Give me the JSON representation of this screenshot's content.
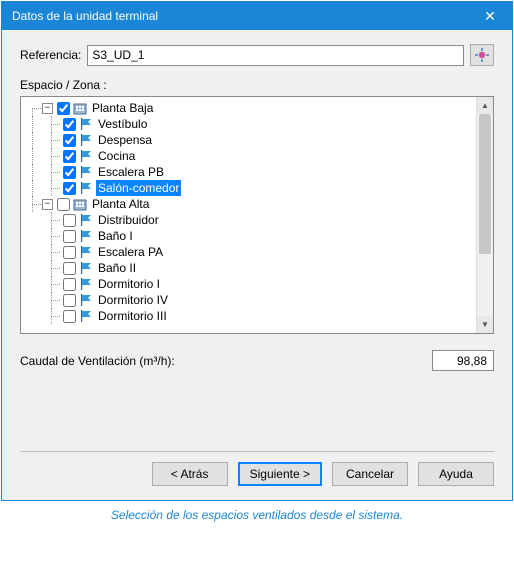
{
  "window": {
    "title": "Datos de la unidad terminal",
    "close_glyph": "✕"
  },
  "reference": {
    "label": "Referencia:",
    "value": "S3_UD_1"
  },
  "section_label": "Espacio / Zona :",
  "tree": {
    "groups": [
      {
        "label": "Planta Baja",
        "expanded": true,
        "checked": true,
        "children": [
          {
            "label": "Vestíbulo",
            "checked": true,
            "selected": false
          },
          {
            "label": "Despensa",
            "checked": true,
            "selected": false
          },
          {
            "label": "Cocina",
            "checked": true,
            "selected": false
          },
          {
            "label": "Escalera PB",
            "checked": true,
            "selected": false
          },
          {
            "label": "Salón-comedor",
            "checked": true,
            "selected": true
          }
        ]
      },
      {
        "label": "Planta Alta",
        "expanded": true,
        "checked": false,
        "children": [
          {
            "label": "Distribuidor",
            "checked": false,
            "selected": false
          },
          {
            "label": "Baño I",
            "checked": false,
            "selected": false
          },
          {
            "label": "Escalera PA",
            "checked": false,
            "selected": false
          },
          {
            "label": "Baño II",
            "checked": false,
            "selected": false
          },
          {
            "label": "Dormitorio I",
            "checked": false,
            "selected": false
          },
          {
            "label": "Dormitorio IV",
            "checked": false,
            "selected": false
          },
          {
            "label": "Dormitorio III",
            "checked": false,
            "selected": false
          }
        ]
      }
    ]
  },
  "caudal": {
    "label": "Caudal de Ventilación (m³/h):",
    "value": "98,88"
  },
  "buttons": {
    "back": "< Atrás",
    "next": "Siguiente >",
    "cancel": "Cancelar",
    "help": "Ayuda"
  },
  "caption": "Selección de los espacios ventilados desde el sistema.",
  "glyphs": {
    "minus": "−",
    "up": "▲",
    "down": "▼"
  }
}
